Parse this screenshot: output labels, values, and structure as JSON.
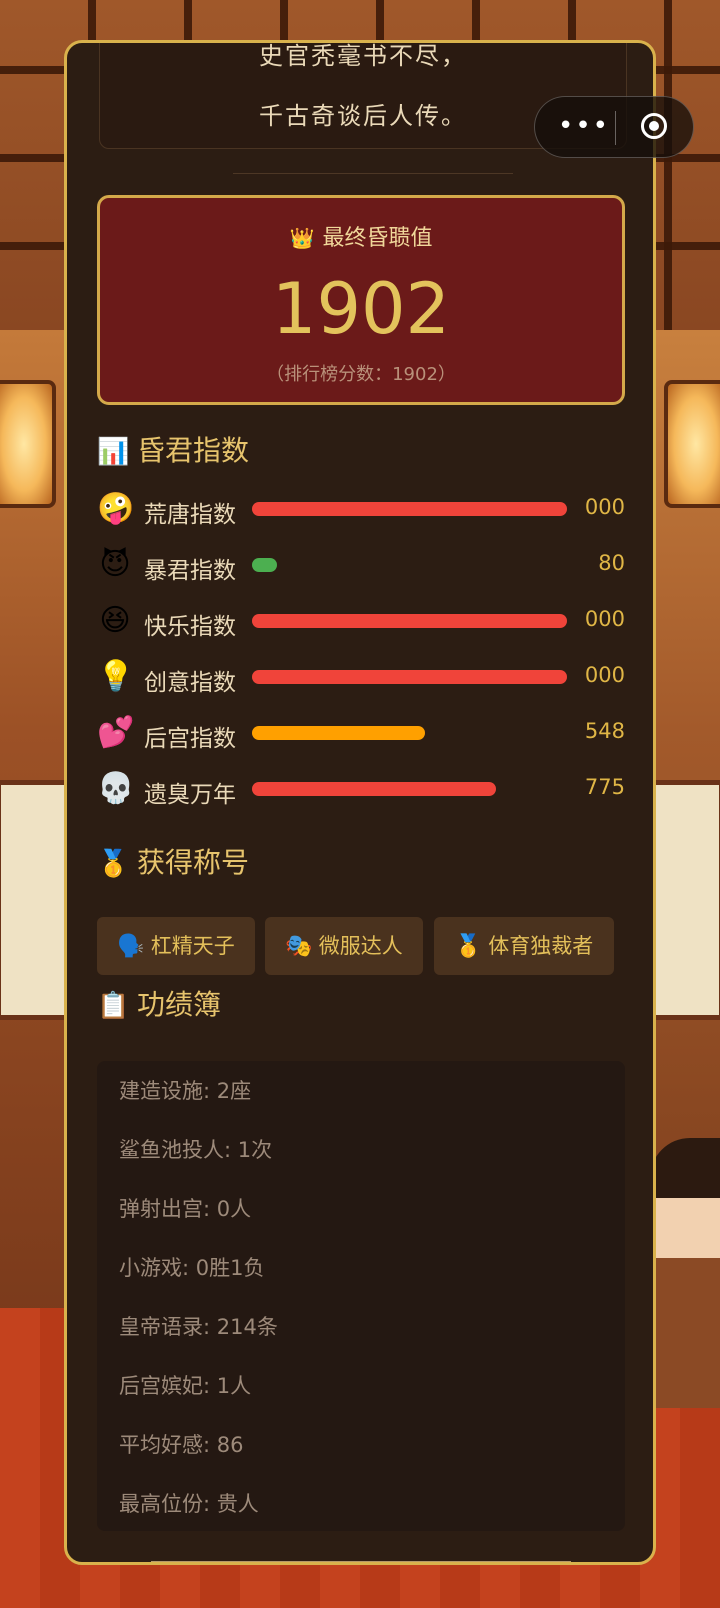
{
  "poem": {
    "line1": "史官秃毫书不尽，",
    "line2": "千古奇谈后人传。"
  },
  "score": {
    "title": "最终昏聩值",
    "crown_icon": "👑",
    "value": "1902",
    "subtitle": "（排行榜分数：1902）"
  },
  "stats_section": {
    "icon": "📊",
    "title": "昏君指数"
  },
  "stats": [
    {
      "emoji": "🤪",
      "label": "荒唐指数",
      "value": "000",
      "level": 1.0,
      "color": "#f0443a"
    },
    {
      "emoji": "😈",
      "label": "暴君指数",
      "value": "80",
      "level": 0.08,
      "color": "#4caf50"
    },
    {
      "emoji": "😆",
      "label": "快乐指数",
      "value": "000",
      "level": 1.0,
      "color": "#f0443a"
    },
    {
      "emoji": "💡",
      "label": "创意指数",
      "value": "000",
      "level": 1.0,
      "color": "#f0443a"
    },
    {
      "emoji": "💕",
      "label": "后宫指数",
      "value": "548",
      "level": 0.548,
      "color": "#ffa000"
    },
    {
      "emoji": "💀",
      "label": "遗臭万年",
      "value": "775",
      "level": 0.775,
      "color": "#f0443a"
    }
  ],
  "titles_section": {
    "icon": "🥇",
    "title": "获得称号"
  },
  "titles": [
    {
      "icon": "🗣️",
      "label": "杠精天子"
    },
    {
      "icon": "🎭",
      "label": "微服达人"
    },
    {
      "icon": "🥇",
      "label": "体育独裁者"
    }
  ],
  "records_section": {
    "icon": "📋",
    "title": "功绩簿"
  },
  "records": [
    "建造设施: 2座",
    "鲨鱼池投人: 1次",
    "弹射出宫: 0人",
    "小游戏: 0胜1负",
    "皇帝语录: 214条",
    "后宫嫔妃: 1人",
    "平均好感: 86",
    "最高位份: 贵人"
  ],
  "capsule": {
    "more_icon": "•••"
  }
}
